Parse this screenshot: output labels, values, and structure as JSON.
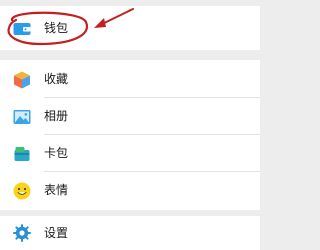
{
  "menu": {
    "wallet_label": "钱包",
    "favorites_label": "收藏",
    "album_label": "相册",
    "cards_label": "卡包",
    "stickers_label": "表情",
    "settings_label": "设置"
  },
  "icons": {
    "wallet": "wallet-icon",
    "favorites": "favorites-cube-icon",
    "album": "album-photo-icon",
    "cards": "cards-wallet-icon",
    "stickers": "smiley-icon",
    "settings": "gear-icon"
  },
  "colors": {
    "background": "#ededed",
    "row": "#ffffff",
    "annotation": "#c41e20",
    "wallet_icon": "#2b9de8",
    "album_icon": "#3aa4e8",
    "stickers_icon": "#f7d51d"
  }
}
